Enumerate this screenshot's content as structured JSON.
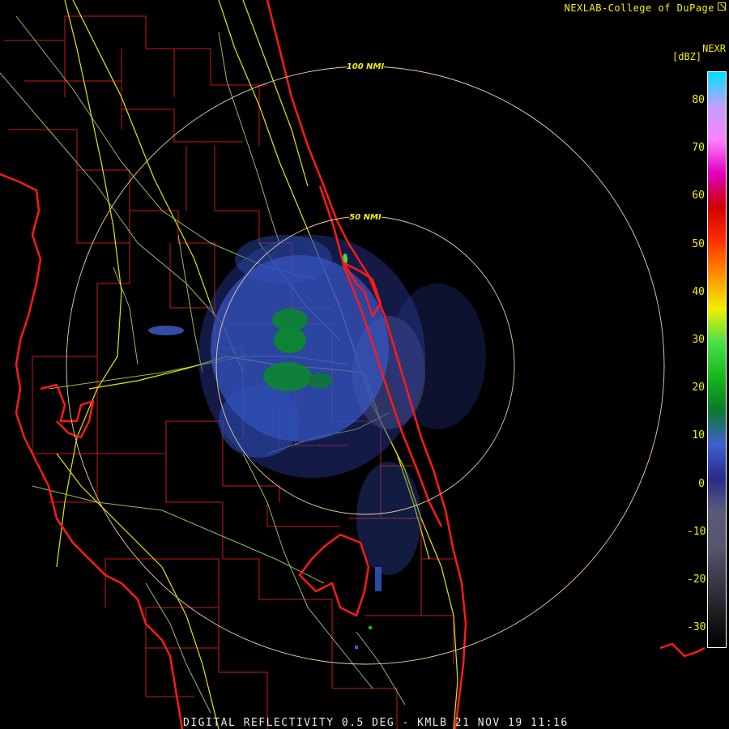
{
  "header": {
    "credit": "NEXLAB-College of DuPage",
    "product": "NEXR",
    "units": "[dBZ]"
  },
  "range_rings": [
    {
      "label": "100 NMI"
    },
    {
      "label": "50 NMI"
    }
  ],
  "legend": {
    "ticks": [
      "80",
      "70",
      "60",
      "50",
      "40",
      "30",
      "20",
      "10",
      "0",
      "-10",
      "-20",
      "-30"
    ],
    "colors": [
      "#000000",
      "#1e1e1e",
      "#3a3a4a",
      "#56566e",
      "#5a5a7a",
      "#2a2a8a",
      "#4060d0",
      "#0a7a2a",
      "#18b818",
      "#48e048",
      "#f0f000",
      "#ff9000",
      "#ff3000",
      "#d00000",
      "#e000c0",
      "#ff80ff",
      "#c0a0ff",
      "#00e0ff"
    ],
    "map_colors": {
      "coast": "#ff1a1a",
      "county": "#c81818",
      "highway": "#e6e600",
      "road": "#a8e070",
      "ring": "#f0d0a0"
    }
  },
  "footer": "DIGITAL REFLECTIVITY 0.5 DEG - KMLB 21 NOV 19 11:16"
}
